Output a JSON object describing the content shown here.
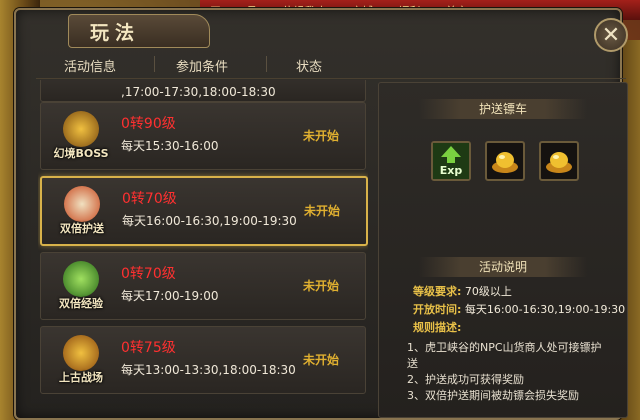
{
  "window": {
    "title": "玩法",
    "close_glyph": "✕"
  },
  "top_strip": {
    "items": [
      "天",
      "月",
      "位规我欢",
      "商城",
      "福利",
      "首充"
    ]
  },
  "header": {
    "col1": "活动信息",
    "col2": "参加条件",
    "col3": "状态"
  },
  "partial_row": {
    "time": ",17:00-17:30,18:00-18:30"
  },
  "activities": [
    {
      "emblem_label": "幻境BOSS",
      "level": "0转90级",
      "time": "每天15:30-16:00",
      "status": "未开始",
      "selected": false,
      "color": "#b8860b"
    },
    {
      "emblem_label": "双倍护送",
      "level": "0转70级",
      "time": "每天16:00-16:30,19:00-19:30",
      "status": "未开始",
      "selected": true,
      "color": "#c84a20"
    },
    {
      "emblem_label": "双倍经验",
      "level": "0转70级",
      "time": "每天17:00-19:00",
      "status": "未开始",
      "selected": false,
      "color": "#3a8a2a"
    },
    {
      "emblem_label": "上古战场",
      "level": "0转75级",
      "time": "每天13:00-13:30,18:00-18:30",
      "status": "未开始",
      "selected": false,
      "color": "#b8860b"
    }
  ],
  "detail": {
    "reward_title": "护送镖车",
    "rewards": [
      {
        "icon": "exp-icon",
        "text": "Exp"
      },
      {
        "icon": "gold-ingot-icon",
        "text": ""
      },
      {
        "icon": "gold-ingot-icon",
        "text": ""
      }
    ],
    "desc_title": "活动说明",
    "level_req_label": "等级要求:",
    "level_req_value": "70级以上",
    "open_time_label": "开放时间:",
    "open_time_value": "每天16:00-16:30,19:00-19:30",
    "rules_label": "规则描述:",
    "rules": [
      "1、虎卫峡谷的NPC山货商人处可接镖护",
      "送",
      "2、护送成功可获得奖励",
      "3、双倍护送期间被劫镖会损失奖励"
    ]
  }
}
